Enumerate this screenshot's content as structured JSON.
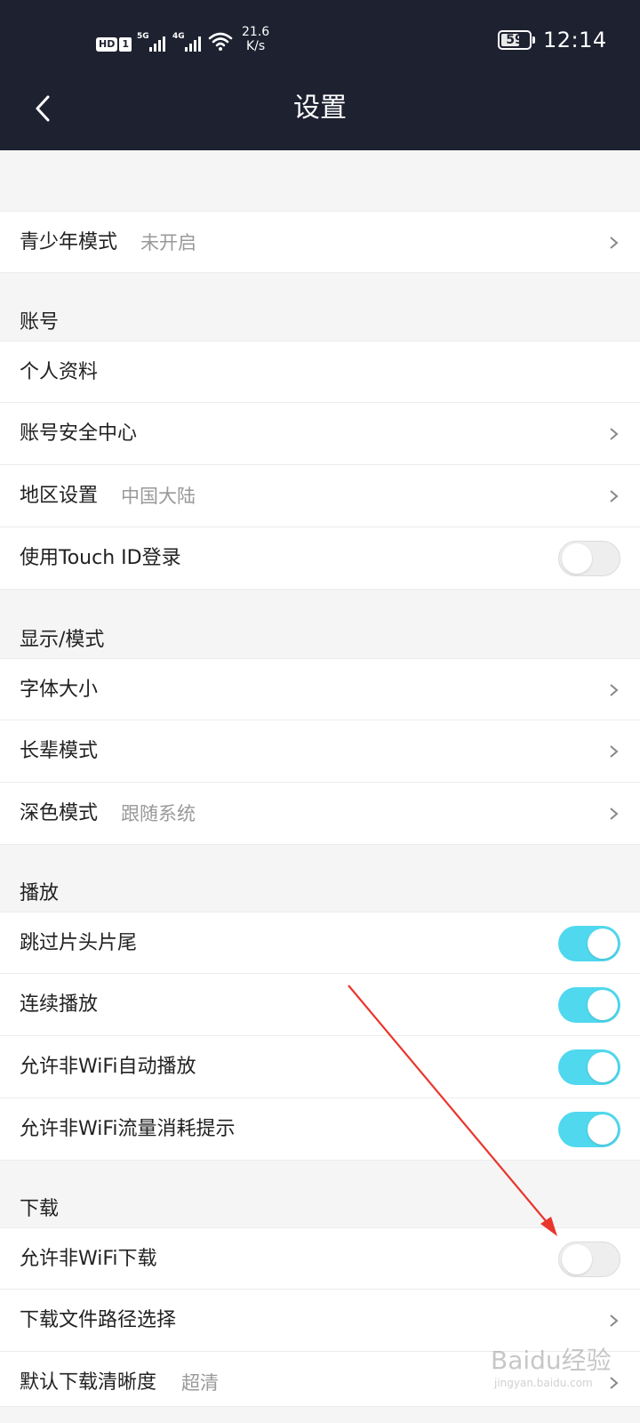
{
  "status_bar": {
    "hd": "HD",
    "sim": "1",
    "net1": "5G",
    "net2": "4G",
    "speed_value": "21.6",
    "speed_unit": "K/s",
    "battery": "59",
    "battery_level": 0.59,
    "time": "12:14"
  },
  "header": {
    "title": "设置"
  },
  "top_section": {
    "teen_mode": {
      "label": "青少年模式",
      "value": "未开启"
    }
  },
  "account": {
    "label": "账号",
    "profile": "个人资料",
    "security_center": "账号安全中心",
    "region": {
      "label": "地区设置",
      "value": "中国大陆"
    },
    "touch_id": {
      "label": "使用Touch ID登录",
      "enabled": false
    }
  },
  "display": {
    "label": "显示/模式",
    "font_size": "字体大小",
    "elder_mode": "长辈模式",
    "dark_mode": {
      "label": "深色模式",
      "value": "跟随系统"
    }
  },
  "playback": {
    "label": "播放",
    "skip_intro": {
      "label": "跳过片头片尾",
      "enabled": true
    },
    "continuous": {
      "label": "连续播放",
      "enabled": true
    },
    "non_wifi_autoplay": {
      "label": "允许非WiFi自动播放",
      "enabled": true
    },
    "non_wifi_data_hint": {
      "label": "允许非WiFi流量消耗提示",
      "enabled": true
    }
  },
  "download": {
    "label": "下载",
    "non_wifi_download": {
      "label": "允许非WiFi下载",
      "enabled": false
    },
    "path": "下载文件路径选择",
    "quality": {
      "label": "默认下载清晰度",
      "value": "超清"
    }
  },
  "annotation": {
    "arrow_color": "#e8362c"
  },
  "watermark": {
    "text": "Baidu经验",
    "sub": "jingyan.baidu.com"
  },
  "colors": {
    "header_bg": "#1e2130",
    "toggle_on": "#4fd8ee",
    "page_bg": "#f5f5f5"
  }
}
